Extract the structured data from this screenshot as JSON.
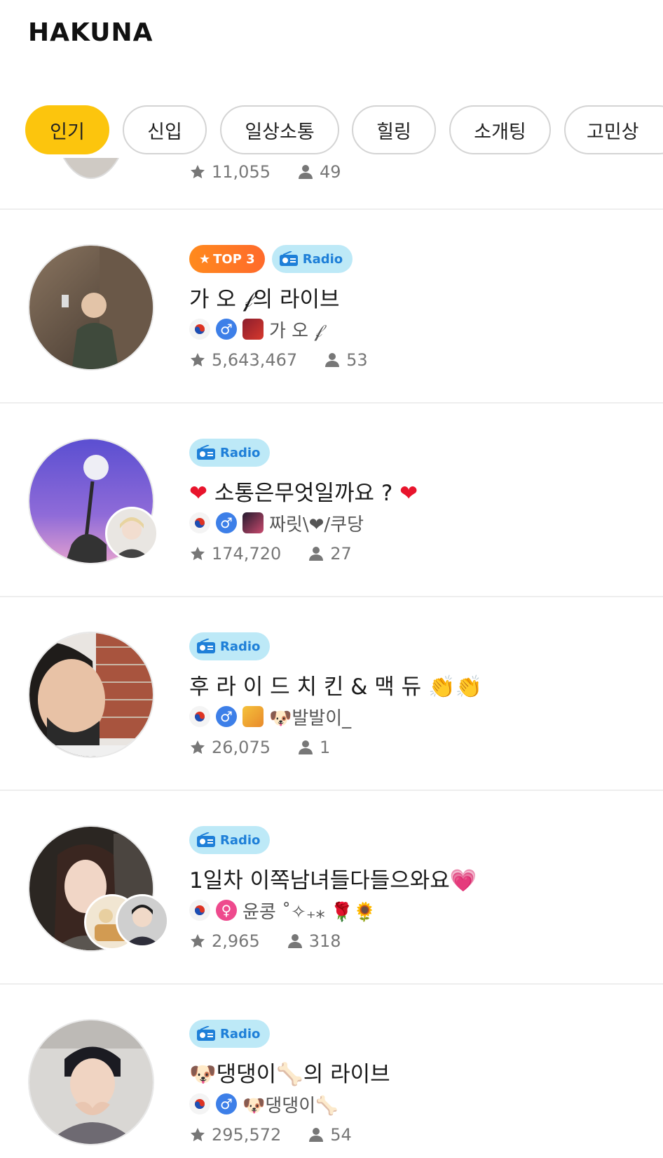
{
  "app": {
    "logo": "HAKUNA"
  },
  "categories": [
    {
      "label": "인기",
      "active": true
    },
    {
      "label": "신입",
      "active": false
    },
    {
      "label": "일상소통",
      "active": false
    },
    {
      "label": "힐링",
      "active": false
    },
    {
      "label": "소개팅",
      "active": false
    },
    {
      "label": "고민상",
      "active": false
    }
  ],
  "partial_item": {
    "stars": "11,055",
    "viewers": "49"
  },
  "items": [
    {
      "badges": [
        "TOP 3",
        "Radio"
      ],
      "title": "가 오  𝒻의 라이브",
      "host": "가 오  𝒻",
      "gender": "male",
      "stars": "5,643,467",
      "viewers": "53"
    },
    {
      "badges": [
        "Radio"
      ],
      "title_left": "❤",
      "title": " 소통은무엇일까요 ? ",
      "title_right": "❤",
      "host": "짜릿\\❤/쿠당",
      "gender": "male",
      "stars": "174,720",
      "viewers": "27"
    },
    {
      "badges": [
        "Radio"
      ],
      "title": "후 라 이 드 치 킨 & 맥 듀 👏👏",
      "host": "🐶발발이_",
      "gender": "male",
      "stars": "26,075",
      "viewers": "1"
    },
    {
      "badges": [
        "Radio"
      ],
      "title": "1일차 이쪽남녀들다들으와요💗",
      "host": "윤콩 ˚✧₊⁎ 🌹🌻",
      "gender": "female",
      "stars": "2,965",
      "viewers": "318"
    },
    {
      "badges": [
        "Radio"
      ],
      "title": "🐶댕댕이🦴의 라이브",
      "host": "🐶댕댕이🦴",
      "gender": "male",
      "stars": "295,572",
      "viewers": "54"
    }
  ],
  "colors": {
    "accent": "#fcc50d",
    "radio_bg": "#bde9f7",
    "radio_text": "#1e7fd8",
    "top_badge": "#ff7a22",
    "male": "#3d7fe8",
    "female": "#ee4a8d",
    "stat_text": "#777777"
  },
  "icons": [
    "star-icon",
    "person-icon",
    "radio-icon",
    "korea-flag-icon",
    "male-icon",
    "female-icon"
  ]
}
